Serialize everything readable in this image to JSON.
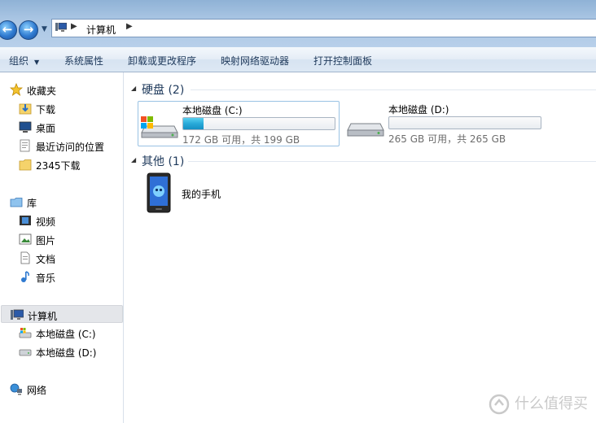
{
  "address": {
    "path": "计算机"
  },
  "toolbar": {
    "organize": "组织",
    "system_properties": "系统属性",
    "uninstall": "卸载或更改程序",
    "map_drive": "映射网络驱动器",
    "control_panel": "打开控制面板"
  },
  "nav": {
    "favorites": {
      "label": "收藏夹",
      "items": [
        "下载",
        "桌面",
        "最近访问的位置",
        "2345下载"
      ]
    },
    "libraries": {
      "label": "库",
      "items": [
        "视频",
        "图片",
        "文档",
        "音乐"
      ]
    },
    "computer": {
      "label": "计算机",
      "items": [
        "本地磁盘 (C:)",
        "本地磁盘 (D:)"
      ]
    },
    "network": {
      "label": "网络"
    }
  },
  "content": {
    "groups": [
      {
        "title": "硬盘 (2)"
      },
      {
        "title": "其他 (1)"
      }
    ],
    "drives": [
      {
        "name": "本地磁盘 (C:)",
        "free_text": "172 GB 可用，共 199 GB",
        "used_fraction": 0.136
      },
      {
        "name": "本地磁盘 (D:)",
        "free_text": "265 GB 可用，共 265 GB",
        "used_fraction": 0.0
      }
    ],
    "devices": [
      {
        "name": "我的手机"
      }
    ]
  },
  "watermark": {
    "text": "什么值得买"
  },
  "colors": {
    "accent": "#1e395b",
    "usage_bar": "#28a9d8",
    "selection": "#99c2e3"
  }
}
